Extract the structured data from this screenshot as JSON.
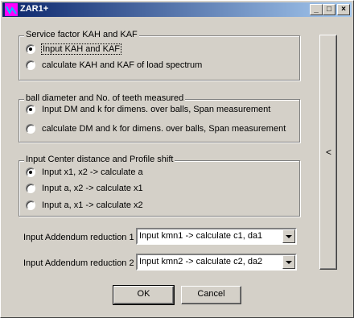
{
  "window": {
    "title": "ZAR1+",
    "controls": {
      "minimize": "_",
      "maximize": "□",
      "close": "×"
    }
  },
  "groups": [
    {
      "legend": "Service factor KAH and KAF",
      "options": [
        {
          "label": "Input KAH and KAF",
          "checked": true
        },
        {
          "label": "calculate KAH and KAF of load spectrum",
          "checked": false
        }
      ]
    },
    {
      "legend": "ball diameter and No. of teeth measured",
      "options": [
        {
          "label": "Input DM and k for dimens. over balls, Span measurement",
          "checked": true
        },
        {
          "label": "calculate DM and k for dimens. over balls, Span measurement",
          "checked": false
        }
      ]
    },
    {
      "legend": "Input Center distance and Profile shift",
      "options": [
        {
          "label": "Input x1, x2  -> calculate a",
          "checked": true
        },
        {
          "label": "Input a, x2  -> calculate x1",
          "checked": false
        },
        {
          "label": "Input a, x1  -> calculate x2",
          "checked": false
        }
      ]
    }
  ],
  "addendum": [
    {
      "label": "Input Addendum reduction 1",
      "value": "Input kmn1  -> calculate c1, da1"
    },
    {
      "label": "Input Addendum reduction 2",
      "value": "Input kmn2  -> calculate c2, da2"
    }
  ],
  "buttons": {
    "ok": "OK",
    "cancel": "Cancel",
    "side": "<"
  },
  "icons": {
    "app": "app-icon"
  }
}
